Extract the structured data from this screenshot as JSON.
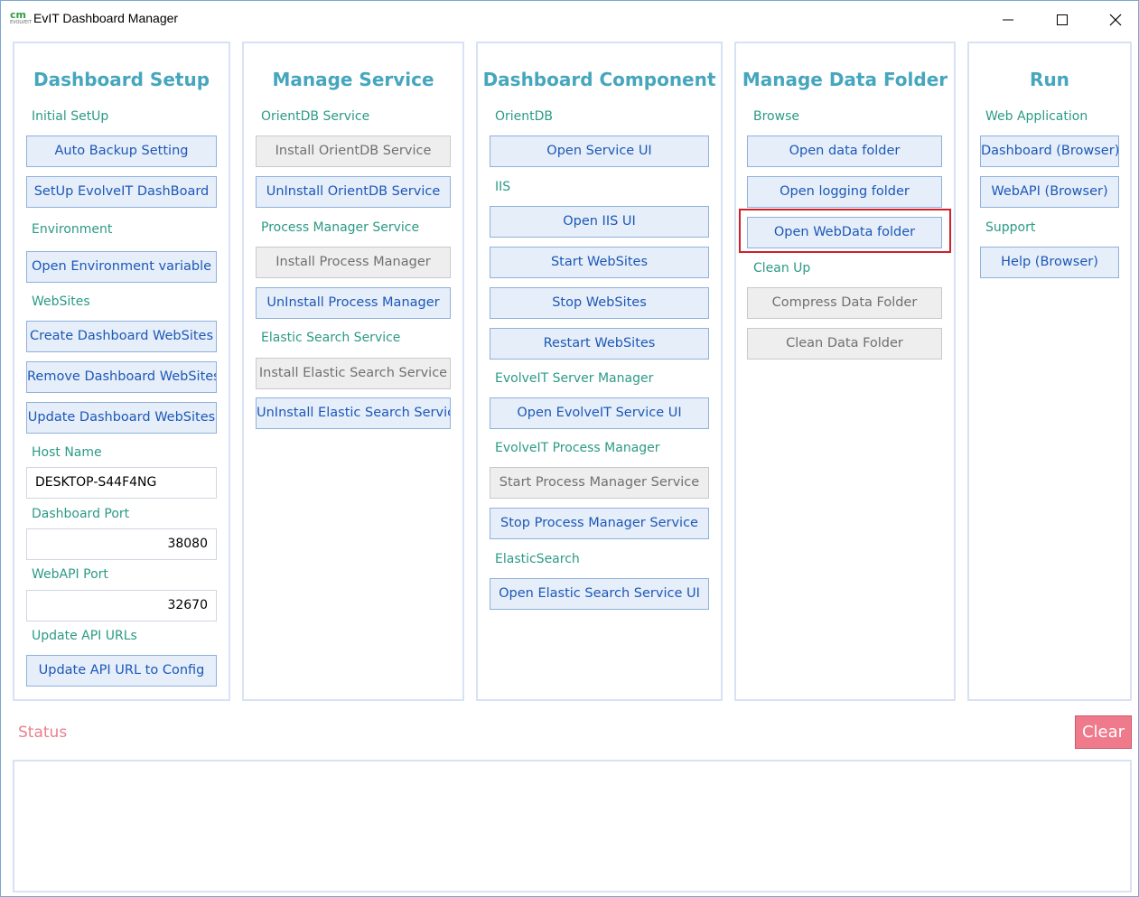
{
  "app": {
    "logo_text": "cm",
    "logo_subtext": "EVOLVEIT",
    "title": "EvIT Dashboard Manager"
  },
  "panels": {
    "setup": {
      "title": "Dashboard Setup",
      "initial_setup_label": "Initial SetUp",
      "auto_backup_button": "Auto Backup Setting",
      "setup_dashboard_button": "SetUp EvolveIT DashBoard",
      "environment_label": "Environment",
      "open_env_button": "Open Environment variable",
      "websites_label": "WebSites",
      "create_websites_button": "Create Dashboard WebSites",
      "remove_websites_button": "Remove Dashboard WebSites",
      "update_websites_button": "Update Dashboard WebSites",
      "host_name_label": "Host Name",
      "host_name_value": "DESKTOP-S44F4NG",
      "dashboard_port_label": "Dashboard Port",
      "dashboard_port_value": "38080",
      "webapi_port_label": "WebAPI Port",
      "webapi_port_value": "32670",
      "update_api_label": "Update API URLs",
      "update_api_button": "Update API URL to Config"
    },
    "service": {
      "title": "Manage Service",
      "orientdb_label": "OrientDB Service",
      "install_orientdb_button": "Install OrientDB Service",
      "uninstall_orientdb_button": "UnInstall OrientDB Service",
      "process_manager_label": "Process Manager Service",
      "install_pm_button": "Install Process Manager",
      "uninstall_pm_button": "UnInstall Process Manager",
      "elastic_label": "Elastic Search Service",
      "install_es_button": "Install Elastic Search Service",
      "uninstall_es_button": "UnInstall Elastic Search Service"
    },
    "component": {
      "title": "Dashboard Component",
      "orientdb_label": "OrientDB",
      "open_service_ui_button": "Open Service UI",
      "iis_label": "IIS",
      "open_iis_button": "Open IIS UI",
      "start_websites_button": "Start WebSites",
      "stop_websites_button": "Stop WebSites",
      "restart_websites_button": "Restart WebSites",
      "server_manager_label": "EvolveIT Server Manager",
      "open_evolveit_button": "Open EvolveIT Service UI",
      "process_manager_label": "EvolveIT Process Manager",
      "start_pm_button": "Start Process Manager Service",
      "stop_pm_button": "Stop Process Manager Service",
      "elastic_label": "ElasticSearch",
      "open_es_button": "Open Elastic Search Service UI"
    },
    "data_folder": {
      "title": "Manage Data Folder",
      "browse_label": "Browse",
      "open_data_button": "Open data folder",
      "open_logging_button": "Open logging folder",
      "open_webdata_button": "Open WebData folder",
      "clean_up_label": "Clean Up",
      "compress_button": "Compress Data Folder",
      "clean_button": "Clean Data Folder"
    },
    "run": {
      "title": "Run",
      "web_app_label": "Web Application",
      "dashboard_browser_button": "Dashboard (Browser)",
      "webapi_browser_button": "WebAPI (Browser)",
      "support_label": "Support",
      "help_button": "Help (Browser)"
    }
  },
  "status": {
    "label": "Status",
    "clear_button": "Clear",
    "content": ""
  },
  "colors": {
    "accent": "#45a6bd",
    "section_label": "#2b9a86",
    "button_text": "#1c58b8",
    "highlight": "#d0202b",
    "clear_button": "#ef7a8c"
  }
}
